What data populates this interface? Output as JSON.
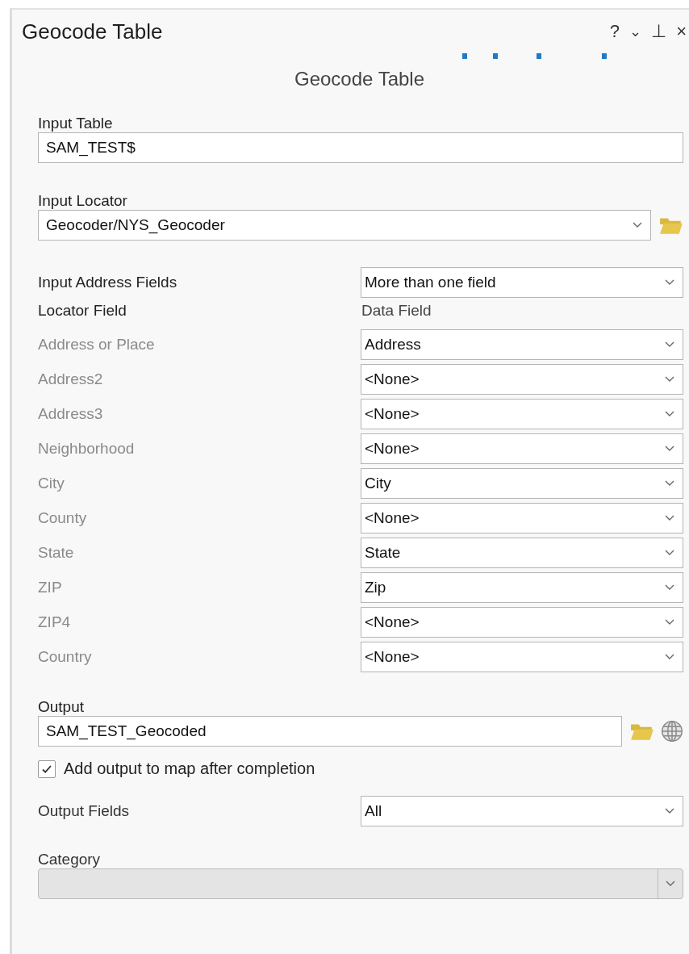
{
  "window": {
    "title": "Geocode Table",
    "controls": [
      "?",
      "⌄",
      "⊥",
      "×"
    ]
  },
  "tool_title": "Geocode Table",
  "input_table": {
    "label": "Input Table",
    "value": "SAM_TEST$"
  },
  "input_locator": {
    "label": "Input Locator",
    "value": "Geocoder/NYS_Geocoder"
  },
  "input_address_fields": {
    "label": "Input Address Fields",
    "value": "More than one field"
  },
  "field_map": {
    "header_left": "Locator Field",
    "header_right": "Data Field",
    "rows": [
      {
        "label": "Address or Place",
        "value": "Address",
        "disabled": true
      },
      {
        "label": "Address2",
        "value": "<None>",
        "disabled": true
      },
      {
        "label": "Address3",
        "value": "<None>",
        "disabled": true
      },
      {
        "label": "Neighborhood",
        "value": "<None>",
        "disabled": true
      },
      {
        "label": "City",
        "value": "City",
        "disabled": true
      },
      {
        "label": "County",
        "value": "<None>",
        "disabled": true
      },
      {
        "label": "State",
        "value": "State",
        "disabled": true
      },
      {
        "label": "ZIP",
        "value": "Zip",
        "disabled": true
      },
      {
        "label": "ZIP4",
        "value": "<None>",
        "disabled": true
      },
      {
        "label": "Country",
        "value": "<None>",
        "disabled": true
      }
    ]
  },
  "output": {
    "label": "Output",
    "value": "SAM_TEST_Geocoded"
  },
  "add_to_map": {
    "label": "Add output to map after completion",
    "checked": true
  },
  "output_fields": {
    "label": "Output Fields",
    "value": "All"
  },
  "category": {
    "label": "Category",
    "disabled": true
  }
}
